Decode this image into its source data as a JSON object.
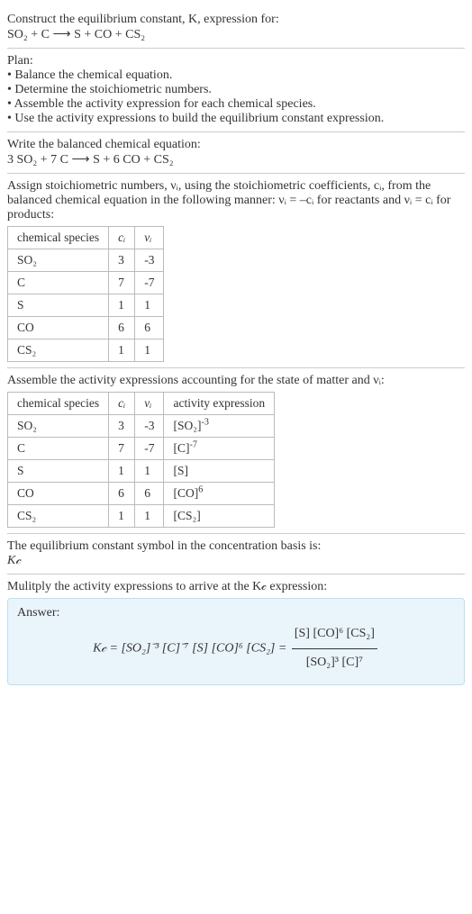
{
  "title_line1": "Construct the equilibrium constant, K, expression for:",
  "title_eq_lhs": "SO₂ + C",
  "title_eq_arrow": "⟶",
  "title_eq_rhs": "S + CO + CS₂",
  "plan_header": "Plan:",
  "plan_items": [
    "• Balance the chemical equation.",
    "• Determine the stoichiometric numbers.",
    "• Assemble the activity expression for each chemical species.",
    "• Use the activity expressions to build the equilibrium constant expression."
  ],
  "balanced_header": "Write the balanced chemical equation:",
  "balanced_eq": "3 SO₂ + 7 C ⟶ S + 6 CO + CS₂",
  "assign_text": "Assign stoichiometric numbers, νᵢ, using the stoichiometric coefficients, cᵢ, from the balanced chemical equation in the following manner: νᵢ = –cᵢ for reactants and νᵢ = cᵢ for products:",
  "table1": {
    "headers": [
      "chemical species",
      "cᵢ",
      "νᵢ"
    ],
    "rows": [
      [
        "SO₂",
        "3",
        "-3"
      ],
      [
        "C",
        "7",
        "-7"
      ],
      [
        "S",
        "1",
        "1"
      ],
      [
        "CO",
        "6",
        "6"
      ],
      [
        "CS₂",
        "1",
        "1"
      ]
    ]
  },
  "assemble_text": "Assemble the activity expressions accounting for the state of matter and νᵢ:",
  "table2": {
    "headers": [
      "chemical species",
      "cᵢ",
      "νᵢ",
      "activity expression"
    ],
    "rows": [
      {
        "sp": "SO₂",
        "c": "3",
        "v": "-3",
        "act_base": "[SO₂]",
        "act_pow": "-3"
      },
      {
        "sp": "C",
        "c": "7",
        "v": "-7",
        "act_base": "[C]",
        "act_pow": "-7"
      },
      {
        "sp": "S",
        "c": "1",
        "v": "1",
        "act_base": "[S]",
        "act_pow": ""
      },
      {
        "sp": "CO",
        "c": "6",
        "v": "6",
        "act_base": "[CO]",
        "act_pow": "6"
      },
      {
        "sp": "CS₂",
        "c": "1",
        "v": "1",
        "act_base": "[CS₂]",
        "act_pow": ""
      }
    ]
  },
  "kc_symbol_text": "The equilibrium constant symbol in the concentration basis is:",
  "kc_symbol": "K𝒸",
  "multiply_text": "Mulitply the activity expressions to arrive at the K𝒸 expression:",
  "answer_label": "Answer:",
  "answer_lhs": "K𝒸 = [SO₂]⁻³ [C]⁻⁷ [S] [CO]⁶ [CS₂] =",
  "answer_num": "[S] [CO]⁶ [CS₂]",
  "answer_den": "[SO₂]³ [C]⁷",
  "chart_data": {
    "type": "table",
    "tables": [
      {
        "title": "Stoichiometric numbers",
        "columns": [
          "chemical species",
          "c_i",
          "ν_i"
        ],
        "rows": [
          [
            "SO2",
            3,
            -3
          ],
          [
            "C",
            7,
            -7
          ],
          [
            "S",
            1,
            1
          ],
          [
            "CO",
            6,
            6
          ],
          [
            "CS2",
            1,
            1
          ]
        ]
      },
      {
        "title": "Activity expressions",
        "columns": [
          "chemical species",
          "c_i",
          "ν_i",
          "activity expression"
        ],
        "rows": [
          [
            "SO2",
            3,
            -3,
            "[SO2]^-3"
          ],
          [
            "C",
            7,
            -7,
            "[C]^-7"
          ],
          [
            "S",
            1,
            1,
            "[S]"
          ],
          [
            "CO",
            6,
            6,
            "[CO]^6"
          ],
          [
            "CS2",
            1,
            1,
            "[CS2]"
          ]
        ]
      }
    ]
  }
}
